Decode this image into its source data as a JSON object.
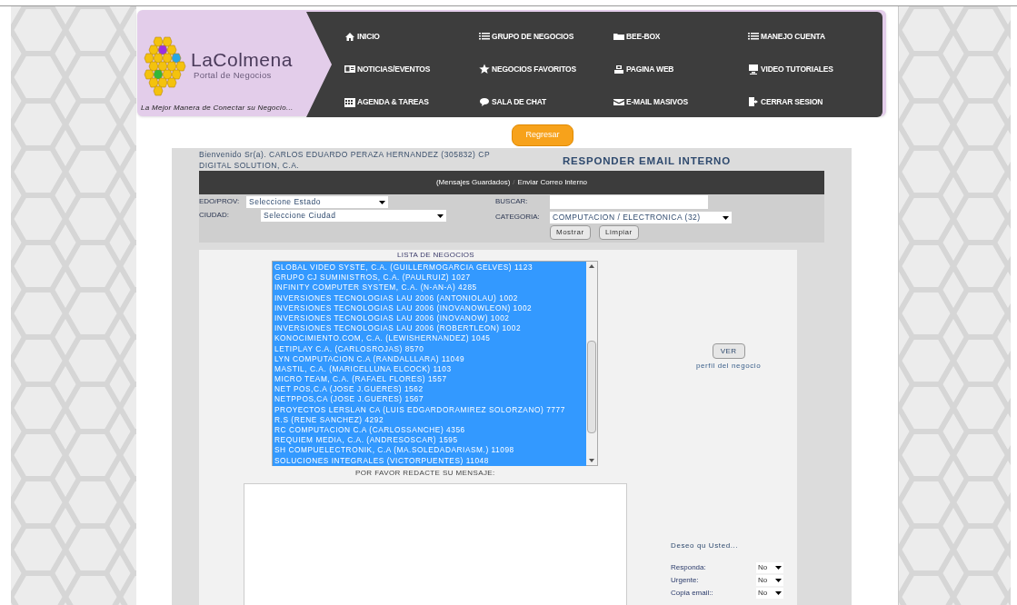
{
  "header": {
    "logo_name": "LaColmena",
    "logo_subtitle": "Portal de Negocios",
    "tagline": "La Mejor Manera de Conectar su Negocio...",
    "menu": [
      "INICIO",
      "GRUPO DE NEGOCIOS",
      "BEE-BOX",
      "MANEJO CUENTA",
      "NOTICIAS/EVENTOS",
      "NEGOCIOS FAVORITOS",
      "PAGINA WEB",
      "VIDEO TUTORIALES",
      "AGENDA & TAREAS",
      "SALA DE CHAT",
      "E-MAIL MASIVOS",
      "CERRAR SESION"
    ]
  },
  "back_button": "Regresar",
  "welcome": "Bienvenido Sr(a). CARLOS EDUARDO PERAZA HERNANDEZ (305832) CP DIGITAL SOLUTION, C.A.",
  "title": "RESPONDER EMAIL INTERNO",
  "nav_links": {
    "saved": "(Mensajes Guardados)",
    "separator": "/",
    "send": "Enviar Correo Interno"
  },
  "filters": {
    "state": {
      "label": "EDO/PROV:",
      "value": "Seleccione Estado"
    },
    "city": {
      "label": "CIUDAD:",
      "value": "Seleccione Ciudad"
    },
    "search": {
      "label": "BUSCAR:"
    },
    "category": {
      "label": "CATEGORIA:",
      "value": "COMPUTACION / ELECTRONICA (32)"
    },
    "buttons": [
      "Mostrar",
      "Limpiar"
    ]
  },
  "business_list": {
    "title": "LISTA DE NEGOCIOS",
    "items": [
      {
        "label": "GLOBAL VIDEO SYSTE, C.A. (GUILLERMOGARCIA GELVES) 1123",
        "selected": true
      },
      {
        "label": "GRUPO CJ SUMINISTROS, C.A. (PAULRUIZ) 1027",
        "selected": true
      },
      {
        "label": "INFINITY COMPUTER SYSTEM, C.A. (N-AN-A) 4285",
        "selected": true
      },
      {
        "label": "INVERSIONES TECNOLOGIAS LAU 2006 (ANTONIOLAU) 1002",
        "selected": true
      },
      {
        "label": "INVERSIONES TECNOLOGIAS LAU 2006 (INOVANOWLEON) 1002",
        "selected": true
      },
      {
        "label": "INVERSIONES TECNOLOGIAS LAU 2006 (INOVANOW) 1002",
        "selected": true
      },
      {
        "label": "INVERSIONES TECNOLOGIAS LAU 2006 (ROBERTLEON) 1002",
        "selected": true
      },
      {
        "label": "KONOCIMIENTO.COM, C.A. (LEWISHERNANDEZ) 1045",
        "selected": true
      },
      {
        "label": "LETIPLAY C.A. (CARLOSROJAS) 8570",
        "selected": true
      },
      {
        "label": "LYN COMPUTACION C.A (RANDALLLARA) 11049",
        "selected": true
      },
      {
        "label": "MASTIL, C.A. (MARICELLUNA ELCOCK) 1103",
        "selected": true
      },
      {
        "label": "MICRO TEAM, C.A. (RAFAEL FLORES) 1557",
        "selected": true
      },
      {
        "label": "NET POS,C.A (JOSE J.GUERES) 1562",
        "selected": true
      },
      {
        "label": "NETPPOS,CA (JOSE J.GUERES) 1567",
        "selected": true
      },
      {
        "label": "PROYECTOS LERSLAN CA (LUIS EDGARDORAMIREZ SOLORZANO) 7777",
        "selected": true
      },
      {
        "label": "R.S (RENE SANCHEZ) 4292",
        "selected": true
      },
      {
        "label": "RC COMPUTACION C.A (CARLOSSANCHE) 4356",
        "selected": true
      },
      {
        "label": "REQUIEM MEDIA, C.A. (ANDRESOSCAR) 1595",
        "selected": true
      },
      {
        "label": "SH COMPUELECTRONIK, C.A (MA.SOLEDADARIASM.) 11098",
        "selected": true
      },
      {
        "label": "SOLUCIONES INTEGRALES (VICTORPUENTES) 11048",
        "selected": true
      }
    ]
  },
  "view_button": "VER",
  "view_caption": "perfil del negocio",
  "message": {
    "label": "POR FAVOR REDACTE SU MENSAJE:"
  },
  "options": {
    "title": "Deseo qu Usted...",
    "items": [
      {
        "label": "Responda:",
        "value": "No"
      },
      {
        "label": "Urgente:",
        "value": "No"
      },
      {
        "label": "Copia email::",
        "value": "No"
      }
    ]
  }
}
